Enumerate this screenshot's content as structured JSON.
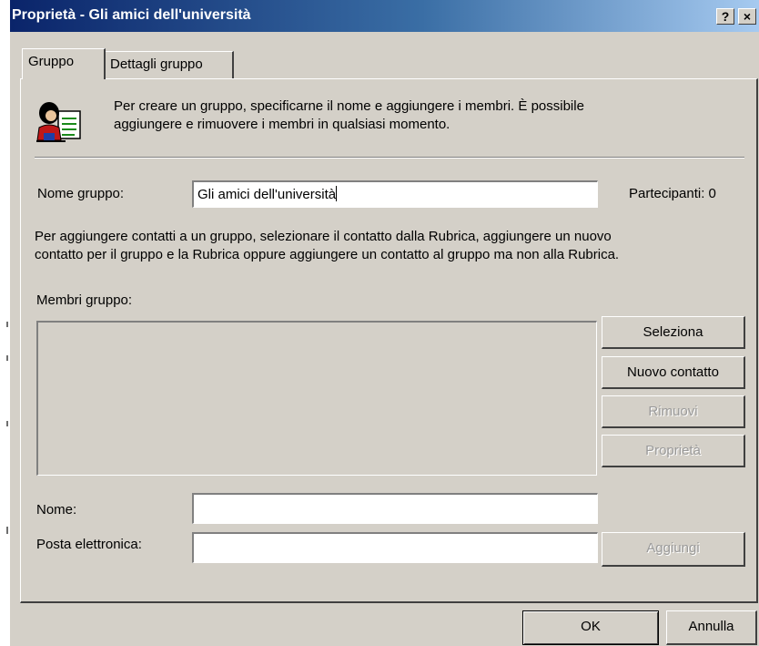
{
  "window": {
    "title": "Proprietà - Gli amici dell'università",
    "help_label": "?",
    "close_label": "×"
  },
  "tabs": [
    {
      "label": "Gruppo",
      "active": true
    },
    {
      "label": "Dettagli gruppo",
      "active": false
    }
  ],
  "intro": {
    "icon": "group-people-icon",
    "line1": "Per creare un gruppo, specificarne il nome e aggiungere i membri. È possibile",
    "line2": "aggiungere e rimuovere i membri in qualsiasi momento."
  },
  "group_name": {
    "label": "Nome gruppo:",
    "value": "Gli amici dell'università",
    "participants": "Partecipanti: 0"
  },
  "description": {
    "line1": "Per aggiungere contatti a un gruppo, selezionare il contatto dalla Rubrica, aggiungere un nuovo",
    "line2": "contatto per il gruppo e la Rubrica oppure aggiungere un contatto al gruppo ma non alla Rubrica."
  },
  "members": {
    "label": "Membri gruppo:",
    "buttons": {
      "select": "Seleziona",
      "new_contact": "Nuovo contatto",
      "remove": "Rimuovi",
      "properties": "Proprietà"
    }
  },
  "contact_form": {
    "name_label": "Nome:",
    "name_value": "",
    "email_label": "Posta elettronica:",
    "email_value": "",
    "add_button": "Aggiungi"
  },
  "footer": {
    "ok": "OK",
    "cancel": "Annulla"
  },
  "colors": {
    "face": "#d4d0c8",
    "title_start": "#0a246a",
    "title_end": "#a6caf0",
    "disabled_text": "#9a9a9a"
  }
}
